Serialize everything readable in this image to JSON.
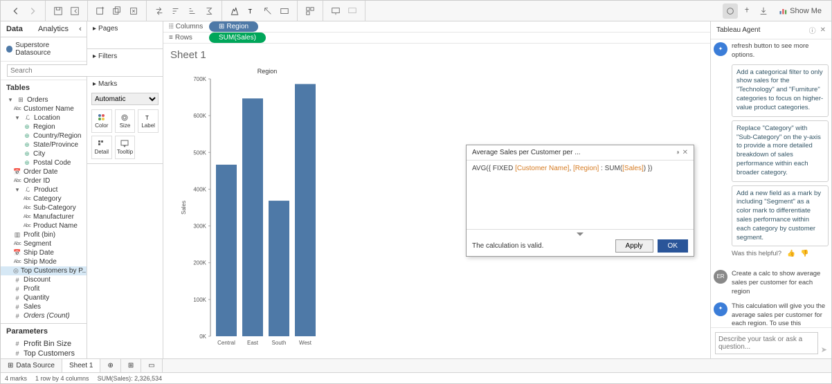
{
  "toolbar": {
    "showme_label": "Show Me"
  },
  "left": {
    "tabs": {
      "data": "Data",
      "analytics": "Analytics"
    },
    "datasource": "Superstore Datasource",
    "search_placeholder": "Search",
    "tables_head": "Tables",
    "params_head": "Parameters",
    "tree": {
      "orders": "Orders",
      "customer_name": "Customer Name",
      "location": "Location",
      "region": "Region",
      "country_region": "Country/Region",
      "state_province": "State/Province",
      "city": "City",
      "postal_code": "Postal Code",
      "order_date": "Order Date",
      "order_id": "Order ID",
      "product": "Product",
      "category": "Category",
      "sub_category": "Sub-Category",
      "manufacturer": "Manufacturer",
      "product_name": "Product Name",
      "profit_bin": "Profit (bin)",
      "segment": "Segment",
      "ship_date": "Ship Date",
      "ship_mode": "Ship Mode",
      "top_customers": "Top Customers by P...",
      "discount": "Discount",
      "profit": "Profit",
      "quantity": "Quantity",
      "sales": "Sales",
      "orders_count": "Orders (Count)"
    },
    "params": {
      "profit_bin_size": "Profit Bin Size",
      "top_customers": "Top Customers"
    }
  },
  "mid": {
    "pages": "Pages",
    "filters": "Filters",
    "marks": "Marks",
    "marks_type": "Automatic",
    "cells": {
      "color": "Color",
      "size": "Size",
      "label": "Label",
      "detail": "Detail",
      "tooltip": "Tooltip"
    }
  },
  "shelves": {
    "columns": "Columns",
    "rows": "Rows",
    "pill_region": "Region",
    "pill_sum_sales": "SUM(Sales)"
  },
  "sheet": {
    "title": "Sheet 1"
  },
  "chart_data": {
    "type": "bar",
    "title": "Region",
    "ylabel": "Sales",
    "categories": [
      "Central",
      "East",
      "South",
      "West"
    ],
    "values": [
      500000,
      693000,
      395000,
      735000
    ],
    "yticks": [
      "0K",
      "100K",
      "200K",
      "300K",
      "400K",
      "500K",
      "600K",
      "700K"
    ],
    "ylim": [
      0,
      750000
    ]
  },
  "calc": {
    "title": "Average Sales per Customer per ...",
    "formula_tokens": [
      {
        "t": "AVG(",
        "c": "fn"
      },
      {
        "t": "{ FIXED ",
        "c": "op"
      },
      {
        "t": "[Customer Name]",
        "c": "field"
      },
      {
        "t": ", ",
        "c": "op"
      },
      {
        "t": "[Region]",
        "c": "field"
      },
      {
        "t": " : ",
        "c": "op"
      },
      {
        "t": "SUM(",
        "c": "fn"
      },
      {
        "t": "[Sales]",
        "c": "field"
      },
      {
        "t": ") })",
        "c": "op"
      }
    ],
    "valid_msg": "The calculation is valid.",
    "apply": "Apply",
    "ok": "OK"
  },
  "agent": {
    "title": "Tableau Agent",
    "top_line": "refresh button to see more options.",
    "suggestions": [
      "Add a categorical filter to only show sales for the \"Technology\" and \"Furniture\" categories to focus on higher-value product categories.",
      "Replace \"Category\" with \"Sub-Category\" on the y-axis to provide a more detailed breakdown of sales performance within each broader category.",
      "Add a new field as a mark by including \"Segment\" as a color mark to differentiate sales performance within each category by customer segment."
    ],
    "helpful": "Was this helpful?",
    "user_msg": "Create a calc to show average sales per customer for each region",
    "user_initials": "ER",
    "reply": "This calculation will give you the average sales per customer for each region. To use this calculated field in your Viz, drag 'Region' to the Rows shelf and the calculated field 'Average Sales per Customer per Region' to the Columns shelf.",
    "input_placeholder": "Describe your task or ask a question..."
  },
  "bottom": {
    "data_source": "Data Source",
    "sheet1": "Sheet 1"
  },
  "status": {
    "marks": "4 marks",
    "dims": "1 row by 4 columns",
    "sum": "SUM(Sales): 2,326,534"
  }
}
